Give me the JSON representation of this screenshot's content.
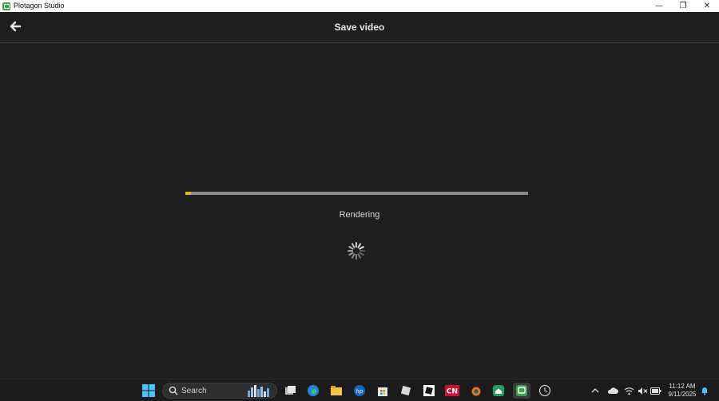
{
  "window": {
    "app_title": "Plotagon Studio",
    "controls": {
      "minimize": "—",
      "restore": "❐",
      "close": "✕"
    }
  },
  "header": {
    "title": "Save video",
    "back_icon": "arrow-left-icon"
  },
  "render": {
    "progress_fraction": 0.016,
    "status": "Rendering",
    "spinner_icon": "loading-spinner-icon"
  },
  "colors": {
    "background": "#1e1e1e",
    "progress_fill": "#f0b400",
    "progress_track": "#8a8a8a"
  },
  "taskbar": {
    "search_label": "Search",
    "time": "11:12 AM",
    "date": "9/11/2025",
    "apps": [
      "task-view-icon",
      "edge-icon",
      "file-explorer-icon",
      "hp-icon",
      "store-icon",
      "roblox-icon",
      "roblox-studio-icon",
      "cn-icon",
      "blender-icon",
      "home-app-icon",
      "plotagon-icon",
      "clock-app-icon"
    ],
    "tray": [
      "chevron-up-icon",
      "onedrive-icon",
      "wifi-icon",
      "volume-muted-icon",
      "battery-icon",
      "notification-bell-icon"
    ]
  }
}
